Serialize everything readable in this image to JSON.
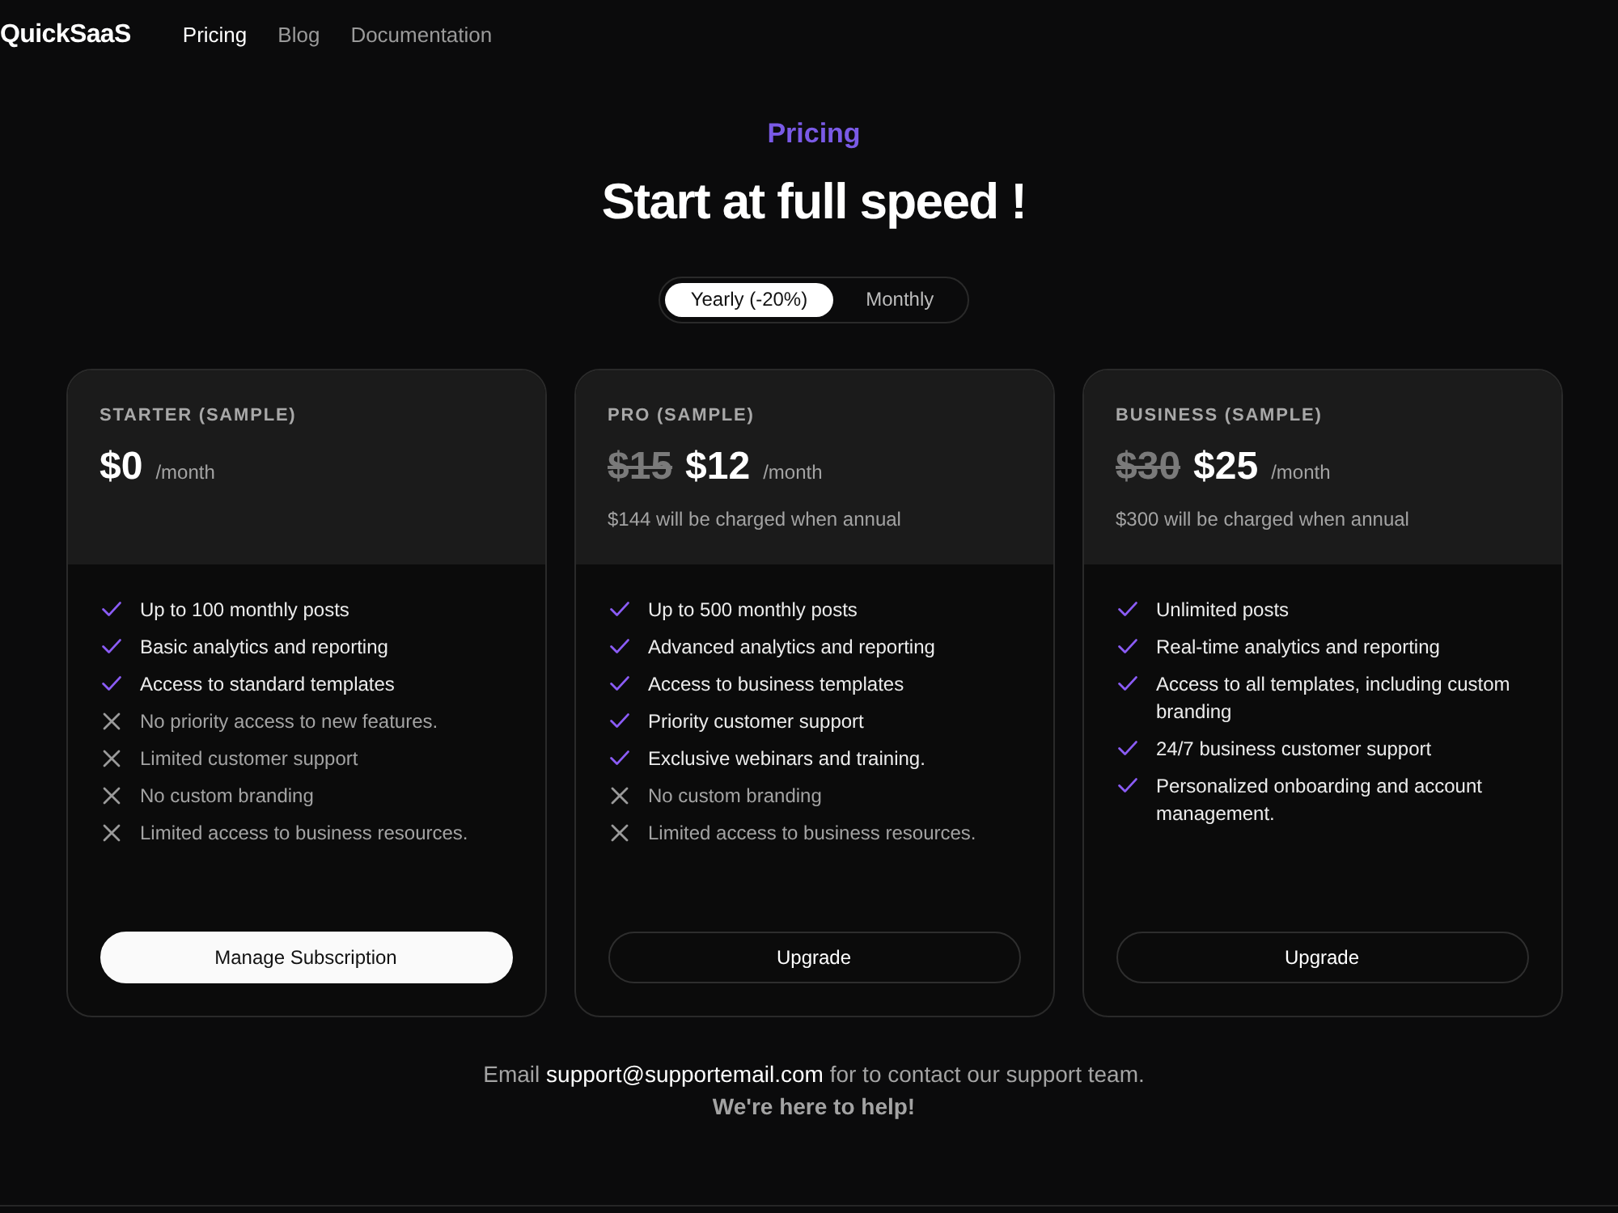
{
  "nav": {
    "logo": "QuickSaaS",
    "links": [
      {
        "label": "Pricing",
        "selected": true
      },
      {
        "label": "Blog",
        "selected": false
      },
      {
        "label": "Documentation",
        "selected": false
      }
    ]
  },
  "hero": {
    "eyebrow": "Pricing",
    "title": "Start at full speed !"
  },
  "billing_toggle": [
    {
      "label": "Yearly (-20%)",
      "selected": true
    },
    {
      "label": "Monthly",
      "selected": false
    }
  ],
  "plans": [
    {
      "name": "STARTER (SAMPLE)",
      "price": "$0",
      "period": "/month",
      "features": [
        {
          "text": "Up to 100 monthly posts",
          "included": true
        },
        {
          "text": "Basic analytics and reporting",
          "included": true
        },
        {
          "text": "Access to standard templates",
          "included": true
        },
        {
          "text": "No priority access to new features.",
          "included": false
        },
        {
          "text": "Limited customer support",
          "included": false
        },
        {
          "text": "No custom branding",
          "included": false
        },
        {
          "text": "Limited access to business resources.",
          "included": false
        }
      ],
      "button": {
        "label": "Manage Subscription",
        "kind": "primary"
      }
    },
    {
      "name": "PRO (SAMPLE)",
      "old_price": "$15",
      "price": "$12",
      "period": "/month",
      "note": "$144 will be charged when annual",
      "features": [
        {
          "text": "Up to 500 monthly posts",
          "included": true
        },
        {
          "text": "Advanced analytics and reporting",
          "included": true
        },
        {
          "text": "Access to business templates",
          "included": true
        },
        {
          "text": "Priority customer support",
          "included": true
        },
        {
          "text": "Exclusive webinars and training.",
          "included": true
        },
        {
          "text": "No custom branding",
          "included": false
        },
        {
          "text": "Limited access to business resources.",
          "included": false
        }
      ],
      "button": {
        "label": "Upgrade",
        "kind": "outline"
      }
    },
    {
      "name": "BUSINESS (SAMPLE)",
      "old_price": "$30",
      "price": "$25",
      "period": "/month",
      "note": "$300 will be charged when annual",
      "features": [
        {
          "text": "Unlimited posts",
          "included": true
        },
        {
          "text": "Real-time analytics and reporting",
          "included": true
        },
        {
          "text": "Access to all templates, including custom branding",
          "included": true
        },
        {
          "text": "24/7 business customer support",
          "included": true
        },
        {
          "text": "Personalized onboarding and account management.",
          "included": true
        }
      ],
      "button": {
        "label": "Upgrade",
        "kind": "outline"
      }
    }
  ],
  "footer": {
    "text_before": "Email",
    "email": "support@supportemail.com",
    "text_after": "for to contact our support team.",
    "tagline": "We're here to help!"
  }
}
